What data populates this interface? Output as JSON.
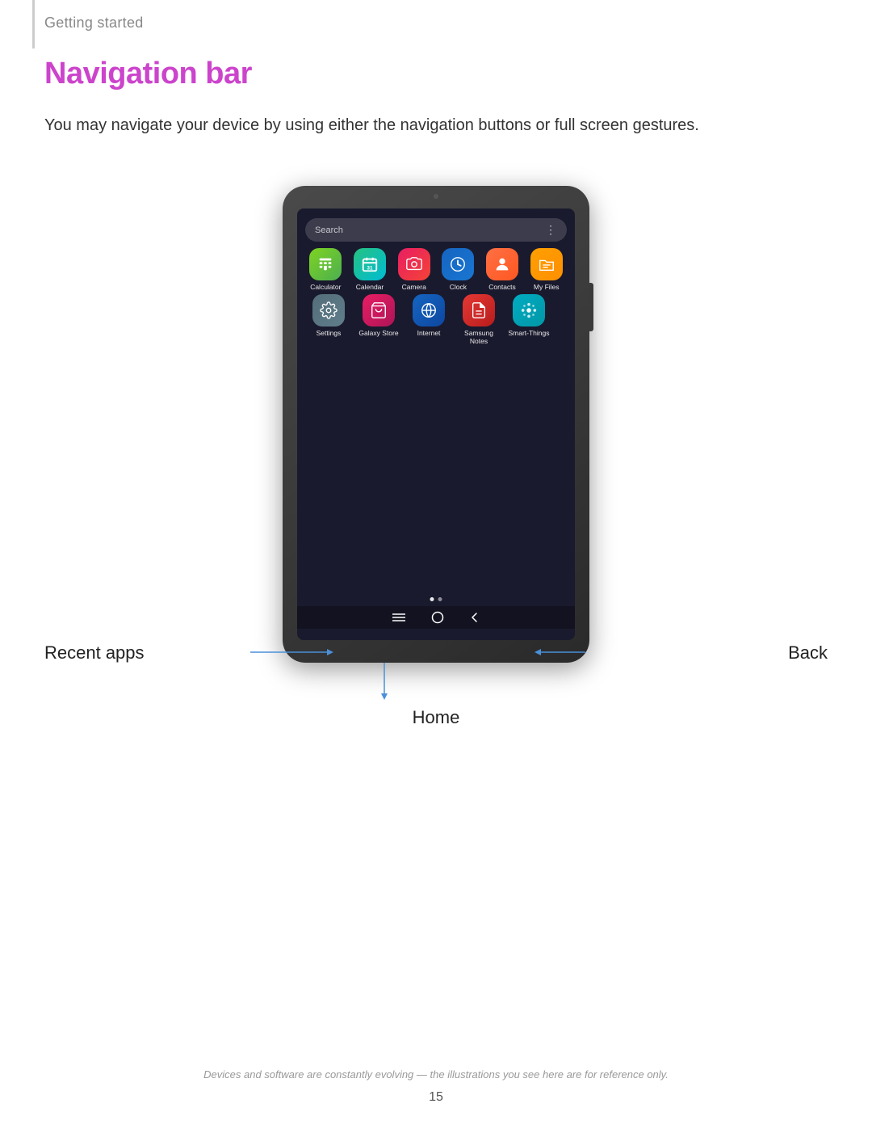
{
  "breadcrumb": "Getting started",
  "page_title": "Navigation bar",
  "description": "You may navigate your device by using either the navigation buttons or full screen gestures.",
  "tablet": {
    "search_placeholder": "Search",
    "apps_row1": [
      {
        "name": "Calculator",
        "icon_class": "icon-calculator",
        "symbol": "✦"
      },
      {
        "name": "Calendar",
        "icon_class": "icon-calendar",
        "symbol": "📅"
      },
      {
        "name": "Camera",
        "icon_class": "icon-camera",
        "symbol": "●"
      },
      {
        "name": "Clock",
        "icon_class": "icon-clock",
        "symbol": "◔"
      },
      {
        "name": "Contacts",
        "icon_class": "icon-contacts",
        "symbol": "👤"
      },
      {
        "name": "My Files",
        "icon_class": "icon-myfiles",
        "symbol": "▤"
      }
    ],
    "apps_row2": [
      {
        "name": "Settings",
        "icon_class": "icon-settings",
        "symbol": "⚙"
      },
      {
        "name": "Galaxy Store",
        "icon_class": "icon-galaxystore",
        "symbol": "🛍"
      },
      {
        "name": "Internet",
        "icon_class": "icon-internet",
        "symbol": "◉"
      },
      {
        "name": "Samsung Notes",
        "icon_class": "icon-samsungnotes",
        "symbol": "✏"
      },
      {
        "name": "Smart-Things",
        "icon_class": "icon-smartthings",
        "symbol": "✳"
      }
    ]
  },
  "labels": {
    "recent_apps": "Recent apps",
    "back": "Back",
    "home": "Home"
  },
  "footer": {
    "disclaimer": "Devices and software are constantly evolving — the illustrations you see here are for reference only.",
    "page_number": "15"
  }
}
